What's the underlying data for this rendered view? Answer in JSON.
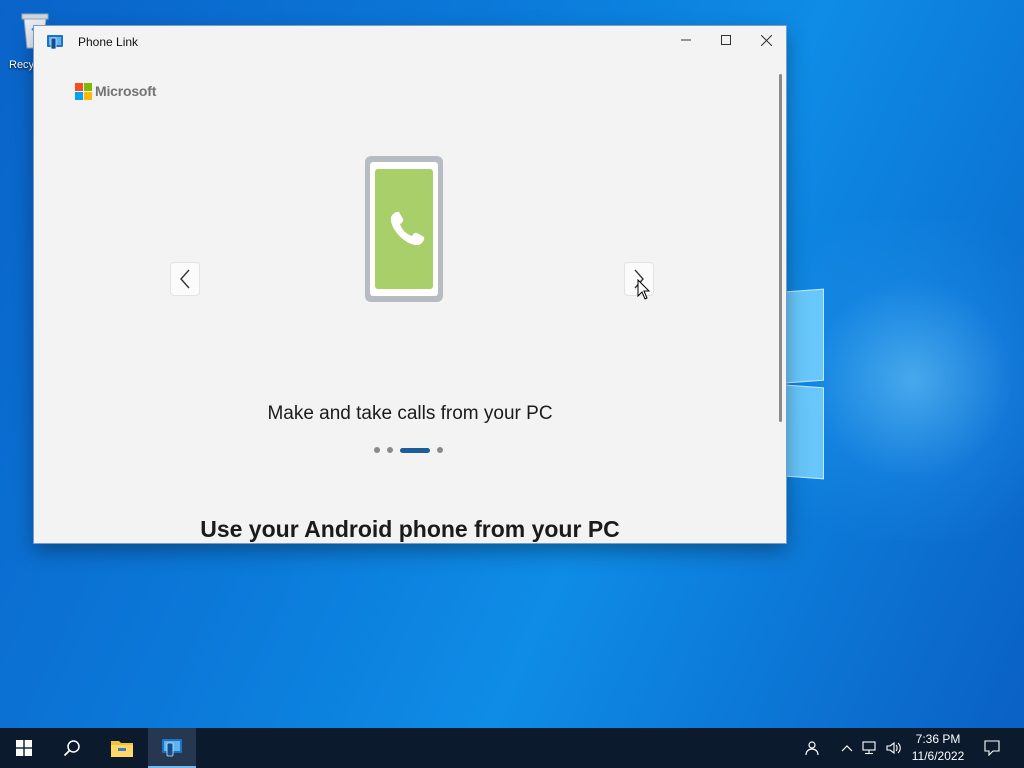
{
  "desktop": {
    "recycle_bin_label": "Recyc"
  },
  "window": {
    "title": "Phone Link",
    "controls": {
      "minimize": "—",
      "maximize": "☐",
      "close": "✕"
    }
  },
  "brand": {
    "text": "Microsoft"
  },
  "carousel": {
    "prev_icon": "chevron-left-icon",
    "next_icon": "chevron-right-icon",
    "caption": "Make and take calls from your PC",
    "slide_count": 4,
    "active_index": 2
  },
  "headline": "Use your Android phone from your PC",
  "taskbar": {
    "time": "7:36 PM",
    "date": "11/6/2022",
    "pinned": [
      "windows-start-icon",
      "search-icon",
      "file-explorer-icon",
      "phone-link-icon"
    ]
  },
  "colors": {
    "phone_screen": "#a8cf6a",
    "phone_frame": "#b7bcc2",
    "dot_active": "#1b5e99",
    "taskbar": "#0b1a2c"
  }
}
